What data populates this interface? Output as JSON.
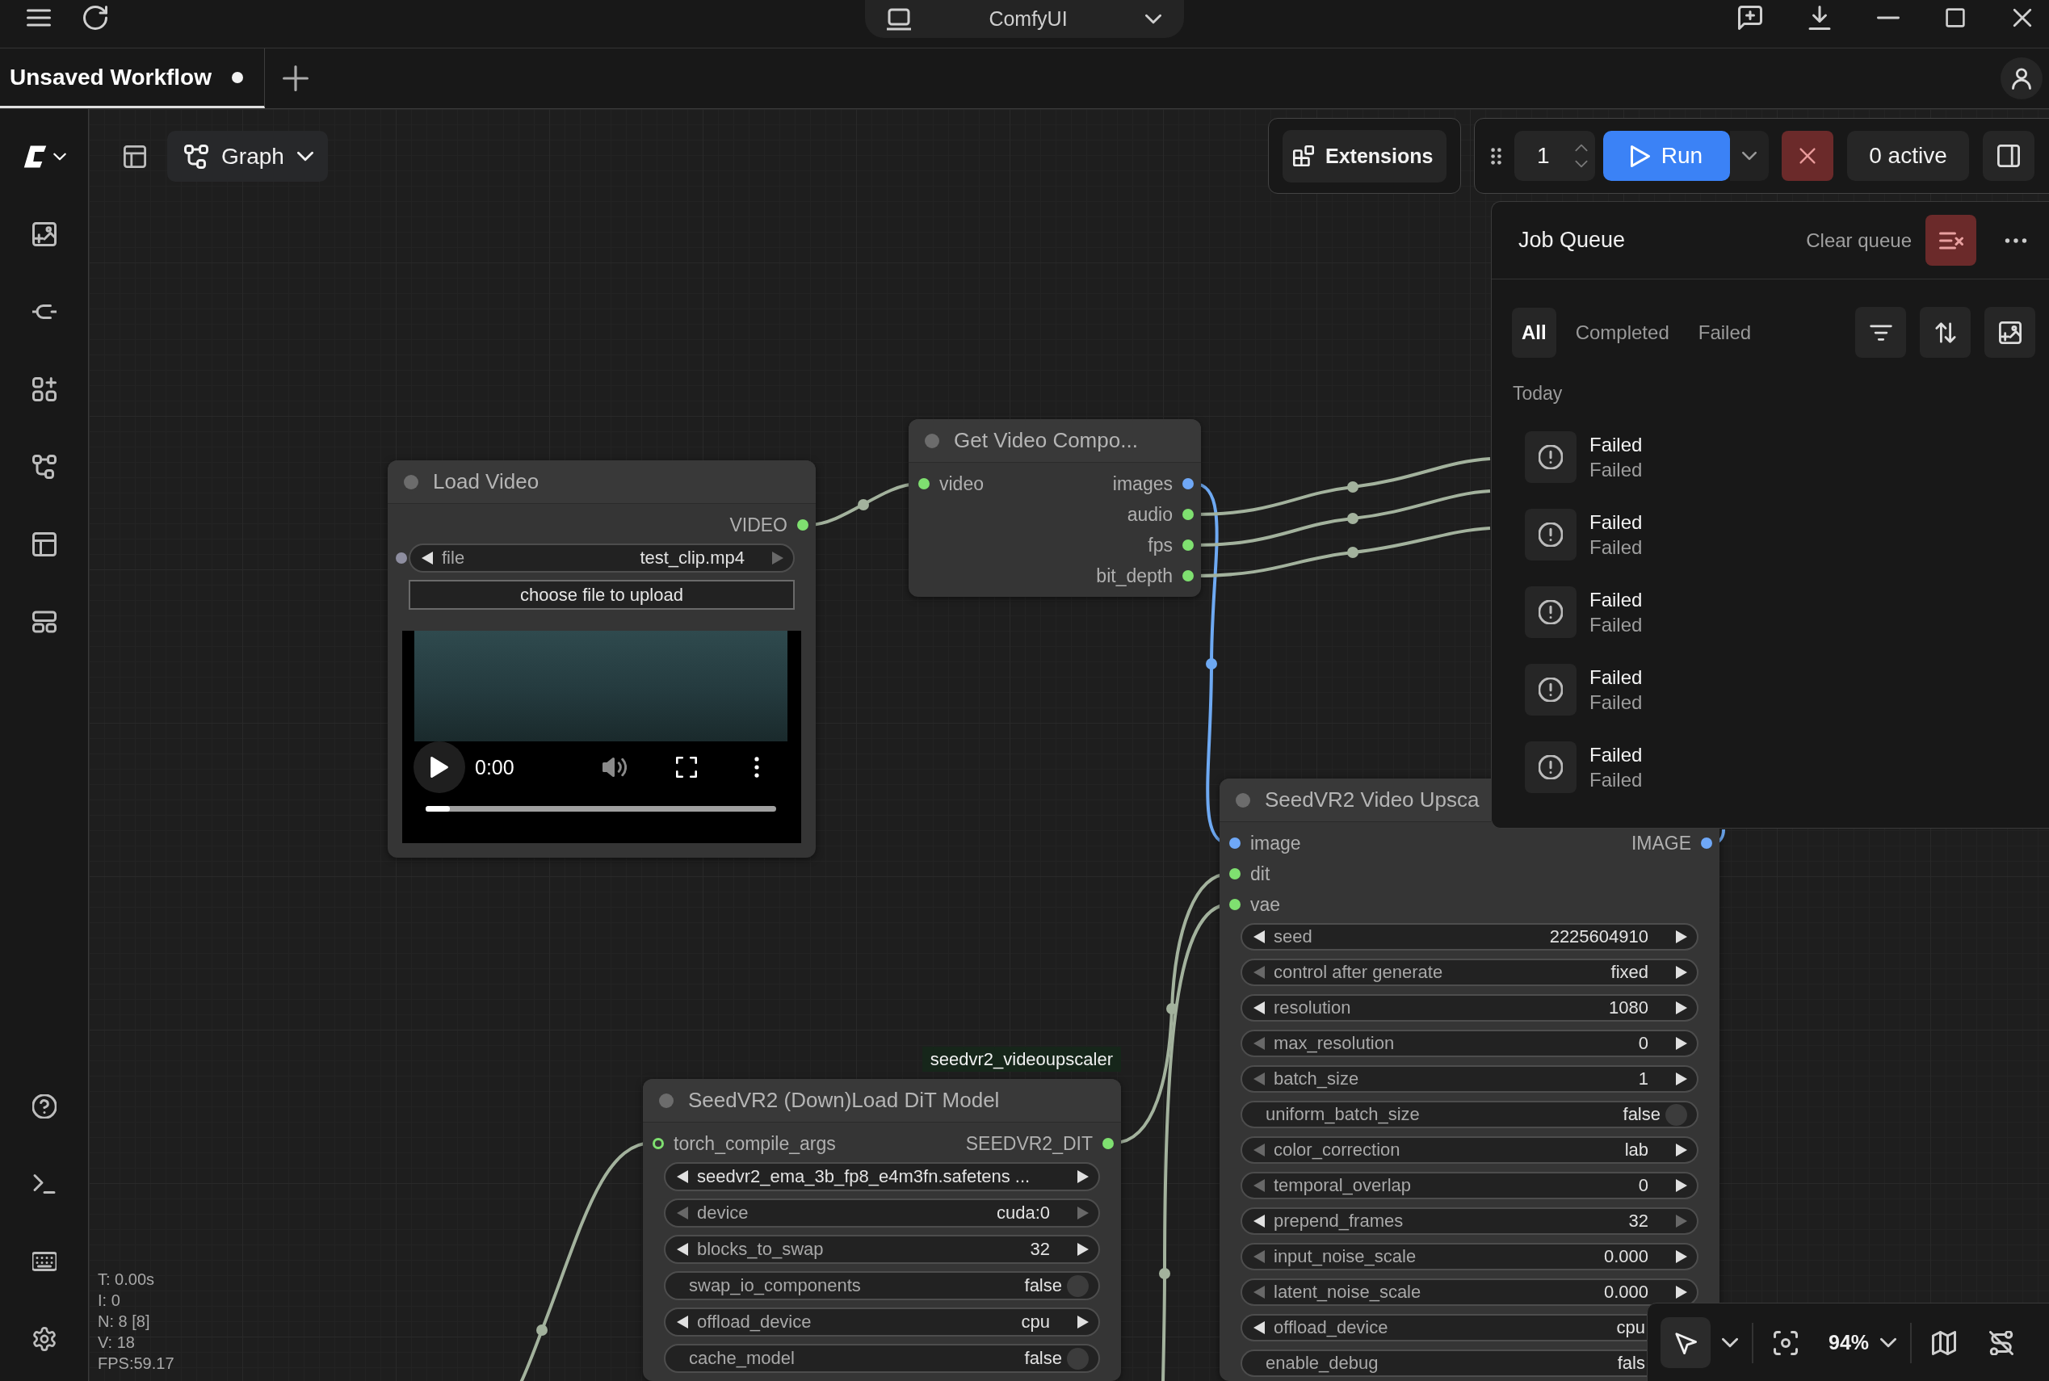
{
  "title_bar": {
    "workspace": "ComfyUI"
  },
  "tabs": [
    {
      "label": "Unsaved Workflow",
      "selected": true,
      "modified": true
    }
  ],
  "graph_toolbar": {
    "view": "Graph"
  },
  "actions": {
    "extensions": "Extensions",
    "batch_count": "1",
    "run": "Run",
    "active": "0 active"
  },
  "job_queue": {
    "title": "Job Queue",
    "clear": "Clear queue",
    "filters": [
      {
        "label": "All",
        "selected": true
      },
      {
        "label": "Completed",
        "selected": false
      },
      {
        "label": "Failed",
        "selected": false
      }
    ],
    "group": "Today",
    "jobs": [
      {
        "title": "Failed",
        "status": "Failed"
      },
      {
        "title": "Failed",
        "status": "Failed"
      },
      {
        "title": "Failed",
        "status": "Failed"
      },
      {
        "title": "Failed",
        "status": "Failed"
      },
      {
        "title": "Failed",
        "status": "Failed"
      }
    ]
  },
  "nodes": [
    {
      "title": "Load Video",
      "outputs": [
        {
          "label": "VIDEO",
          "color": "#7fe070"
        }
      ],
      "widgets": [
        {
          "kind": "combo",
          "label": "file",
          "value": "test_clip.mp4",
          "prev_disabled": false,
          "next_disabled": true,
          "socket": {
            "color": "#8e8ea0"
          }
        },
        {
          "kind": "button",
          "label": "choose file to upload"
        },
        {
          "kind": "video",
          "time": "0:00",
          "level": 0.07
        }
      ]
    },
    {
      "title": "Get Video Compo...",
      "inputs": [
        {
          "label": "video",
          "color": "#7fe070",
          "optional": false
        }
      ],
      "outputs": [
        {
          "label": "images",
          "color": "#6fa8f7"
        },
        {
          "label": "audio",
          "color": "#7fe070"
        },
        {
          "label": "fps",
          "color": "#7fe070"
        },
        {
          "label": "bit_depth",
          "color": "#7fe070"
        }
      ]
    },
    {
      "badge": "seedvr2_videoupscaler",
      "title": "SeedVR2 (Down)Load DiT Model",
      "inputs": [
        {
          "label": "torch_compile_args",
          "color": "#7fe070",
          "optional": true
        }
      ],
      "outputs": [
        {
          "label": "SEEDVR2_DIT",
          "color": "#7fe070"
        }
      ],
      "widgets": [
        {
          "kind": "combo",
          "value": "seedvr2_ema_3b_fp8_e4m3fn.safetens ...",
          "prev_disabled": false,
          "next_disabled": false
        },
        {
          "kind": "combo",
          "label": "device",
          "value": "cuda:0",
          "prev_disabled": true,
          "next_disabled": true
        },
        {
          "kind": "number",
          "label": "blocks_to_swap",
          "value": "32",
          "prev_disabled": false,
          "next_disabled": false
        },
        {
          "kind": "toggle",
          "label": "swap_io_components",
          "value": "false",
          "on": false
        },
        {
          "kind": "combo",
          "label": "offload_device",
          "value": "cpu",
          "prev_disabled": false,
          "next_disabled": false
        },
        {
          "kind": "toggle",
          "label": "cache_model",
          "value": "false",
          "on": false
        }
      ]
    },
    {
      "title": "SeedVR2 Video Upsca",
      "inputs": [
        {
          "label": "image",
          "color": "#6fa8f7",
          "optional": false
        },
        {
          "label": "dit",
          "color": "#7fe070",
          "optional": false
        },
        {
          "label": "vae",
          "color": "#7fe070",
          "optional": false
        }
      ],
      "outputs": [
        {
          "label": "IMAGE",
          "color": "#6fa8f7"
        }
      ],
      "widgets": [
        {
          "kind": "number",
          "label": "seed",
          "value": "2225604910",
          "prev_disabled": false,
          "next_disabled": false
        },
        {
          "kind": "combo",
          "label": "control after generate",
          "value": "fixed",
          "prev_disabled": true,
          "next_disabled": false
        },
        {
          "kind": "number",
          "label": "resolution",
          "value": "1080",
          "prev_disabled": false,
          "next_disabled": false
        },
        {
          "kind": "number",
          "label": "max_resolution",
          "value": "0",
          "prev_disabled": true,
          "next_disabled": false
        },
        {
          "kind": "number",
          "label": "batch_size",
          "value": "1",
          "prev_disabled": true,
          "next_disabled": false
        },
        {
          "kind": "toggle",
          "label": "uniform_batch_size",
          "value": "false",
          "on": false
        },
        {
          "kind": "combo",
          "label": "color_correction",
          "value": "lab",
          "prev_disabled": true,
          "next_disabled": false
        },
        {
          "kind": "number",
          "label": "temporal_overlap",
          "value": "0",
          "prev_disabled": true,
          "next_disabled": false
        },
        {
          "kind": "number",
          "label": "prepend_frames",
          "value": "32",
          "prev_disabled": false,
          "next_disabled": true
        },
        {
          "kind": "number",
          "label": "input_noise_scale",
          "value": "0.000",
          "prev_disabled": true,
          "next_disabled": false
        },
        {
          "kind": "number",
          "label": "latent_noise_scale",
          "value": "0.000",
          "prev_disabled": true,
          "next_disabled": false
        },
        {
          "kind": "combo",
          "label": "offload_device",
          "value": "cpu",
          "prev_disabled": false
        },
        {
          "kind": "toggle",
          "label": "enable_debug",
          "value": "fals"
        }
      ]
    }
  ],
  "stats": [
    "T: 0.00s",
    "I: 0",
    "N: 8 [8]",
    "V: 18",
    "FPS:59.17"
  ],
  "canvas_controls": {
    "zoom": "94%"
  }
}
